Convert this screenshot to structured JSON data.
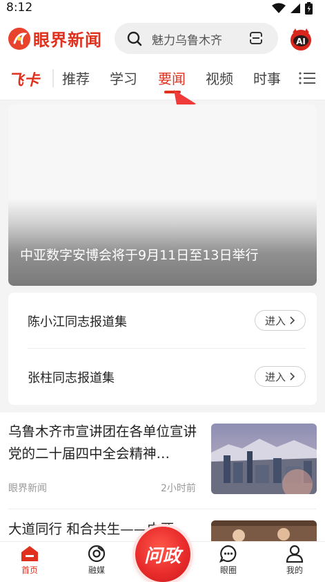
{
  "status_bar": {
    "time": "8:12"
  },
  "header": {
    "app_name": "眼界新闻",
    "search_placeholder": "魅力乌鲁木齐",
    "ai_label": "AI"
  },
  "tabs": {
    "special": "飞卡",
    "items": [
      "推荐",
      "学习",
      "要闻",
      "视频",
      "时事"
    ],
    "active": "要闻"
  },
  "hero": {
    "caption": "中亚数字安博会将于9月11日至13日举行"
  },
  "collections": [
    {
      "title": "陈小江同志报道集",
      "button": "进入"
    },
    {
      "title": "张柱同志报道集",
      "button": "进入"
    }
  ],
  "news": [
    {
      "title": "乌鲁木齐市宣讲团在各单位宣讲党的二十届四中全会精神…",
      "source": "眼界新闻",
      "time": "2小时前"
    },
    {
      "title": "大道同行 和合共生——中亚"
    }
  ],
  "bottom_nav": {
    "items": [
      {
        "label": "首页",
        "icon": "home-icon"
      },
      {
        "label": "融媒",
        "icon": "media-icon"
      },
      {
        "label": "眼圈",
        "icon": "chat-icon"
      },
      {
        "label": "我的",
        "icon": "profile-icon"
      }
    ],
    "center": "问政"
  },
  "colors": {
    "brand": "#e0301e"
  }
}
